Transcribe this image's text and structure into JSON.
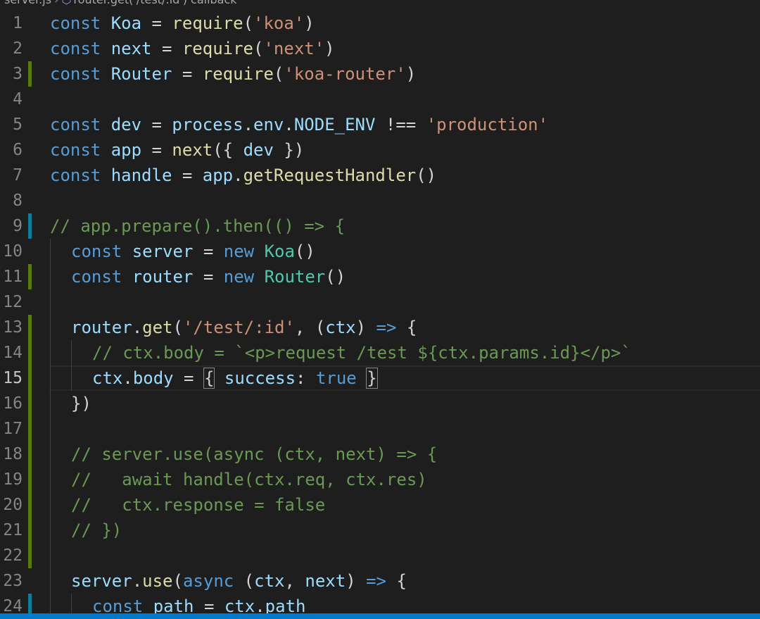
{
  "breadcrumb": {
    "file": "server.js",
    "symbol": "router.get('/test/:id') callback"
  },
  "current_line": 15,
  "lines": [
    {
      "n": "1",
      "tokens": [
        [
          "kw",
          "const "
        ],
        [
          "var",
          "Koa"
        ],
        [
          "op",
          " = "
        ],
        [
          "fn",
          "require"
        ],
        [
          "op",
          "("
        ],
        [
          "str",
          "'koa'"
        ],
        [
          "op",
          ")"
        ]
      ]
    },
    {
      "n": "2",
      "tokens": [
        [
          "kw",
          "const "
        ],
        [
          "var",
          "next"
        ],
        [
          "op",
          " = "
        ],
        [
          "fn",
          "require"
        ],
        [
          "op",
          "("
        ],
        [
          "str",
          "'next'"
        ],
        [
          "op",
          ")"
        ]
      ]
    },
    {
      "n": "3",
      "mark": "green",
      "tokens": [
        [
          "kw",
          "const "
        ],
        [
          "var",
          "Router"
        ],
        [
          "op",
          " = "
        ],
        [
          "fn",
          "require"
        ],
        [
          "op",
          "("
        ],
        [
          "str",
          "'koa-router'"
        ],
        [
          "op",
          ")"
        ]
      ]
    },
    {
      "n": "4",
      "tokens": []
    },
    {
      "n": "5",
      "tokens": [
        [
          "kw",
          "const "
        ],
        [
          "var",
          "dev"
        ],
        [
          "op",
          " = "
        ],
        [
          "var",
          "process"
        ],
        [
          "op",
          "."
        ],
        [
          "var",
          "env"
        ],
        [
          "op",
          "."
        ],
        [
          "var",
          "NODE_ENV"
        ],
        [
          "op",
          " !== "
        ],
        [
          "str",
          "'production'"
        ]
      ]
    },
    {
      "n": "6",
      "tokens": [
        [
          "kw",
          "const "
        ],
        [
          "var",
          "app"
        ],
        [
          "op",
          " = "
        ],
        [
          "fn",
          "next"
        ],
        [
          "op",
          "({ "
        ],
        [
          "var",
          "dev"
        ],
        [
          "op",
          " })"
        ]
      ]
    },
    {
      "n": "7",
      "tokens": [
        [
          "kw",
          "const "
        ],
        [
          "var",
          "handle"
        ],
        [
          "op",
          " = "
        ],
        [
          "var",
          "app"
        ],
        [
          "op",
          "."
        ],
        [
          "fn",
          "getRequestHandler"
        ],
        [
          "op",
          "()"
        ]
      ]
    },
    {
      "n": "8",
      "tokens": []
    },
    {
      "n": "9",
      "mark": "blue",
      "tokens": [
        [
          "cmt",
          "// app.prepare().then(() => {"
        ]
      ]
    },
    {
      "n": "10",
      "indent": 1,
      "tokens": [
        [
          "kw",
          "const "
        ],
        [
          "var",
          "server"
        ],
        [
          "op",
          " = "
        ],
        [
          "kw",
          "new "
        ],
        [
          "cls",
          "Koa"
        ],
        [
          "op",
          "()"
        ]
      ]
    },
    {
      "n": "11",
      "indent": 1,
      "mark": "green",
      "tokens": [
        [
          "kw",
          "const "
        ],
        [
          "var",
          "router"
        ],
        [
          "op",
          " = "
        ],
        [
          "kw",
          "new "
        ],
        [
          "cls",
          "Router"
        ],
        [
          "op",
          "()"
        ]
      ]
    },
    {
      "n": "12",
      "indent": 1,
      "tokens": []
    },
    {
      "n": "13",
      "indent": 1,
      "mark": "green",
      "tokens": [
        [
          "var",
          "router"
        ],
        [
          "op",
          "."
        ],
        [
          "fn",
          "get"
        ],
        [
          "op",
          "("
        ],
        [
          "str",
          "'/test/:id'"
        ],
        [
          "op",
          ", ("
        ],
        [
          "var",
          "ctx"
        ],
        [
          "op",
          ") "
        ],
        [
          "kw",
          "=>"
        ],
        [
          "op",
          " {"
        ]
      ]
    },
    {
      "n": "14",
      "indent": 2,
      "mark": "green",
      "tokens": [
        [
          "cmt",
          "// ctx.body = `<p>request /test ${ctx.params.id}</p>`"
        ]
      ]
    },
    {
      "n": "15",
      "indent": 2,
      "mark": "green",
      "tokens": [
        [
          "var",
          "ctx"
        ],
        [
          "op",
          "."
        ],
        [
          "var",
          "body"
        ],
        [
          "op",
          " = "
        ],
        [
          "brk",
          "{"
        ],
        [
          "op",
          " "
        ],
        [
          "var",
          "success"
        ],
        [
          "op",
          ": "
        ],
        [
          "kw",
          "true"
        ],
        [
          "op",
          " "
        ],
        [
          "brk",
          "}"
        ]
      ]
    },
    {
      "n": "16",
      "indent": 1,
      "mark": "green",
      "tokens": [
        [
          "op",
          "})"
        ]
      ]
    },
    {
      "n": "17",
      "indent": 1,
      "mark": "green",
      "tokens": []
    },
    {
      "n": "18",
      "indent": 1,
      "mark": "green",
      "tokens": [
        [
          "cmt",
          "// server.use(async (ctx, next) => {"
        ]
      ]
    },
    {
      "n": "19",
      "indent": 1,
      "mark": "green",
      "tokens": [
        [
          "cmt",
          "//   await handle(ctx.req, ctx.res)"
        ]
      ]
    },
    {
      "n": "20",
      "indent": 1,
      "mark": "green",
      "tokens": [
        [
          "cmt",
          "//   ctx.response = false"
        ]
      ]
    },
    {
      "n": "21",
      "indent": 1,
      "mark": "green",
      "tokens": [
        [
          "cmt",
          "// })"
        ]
      ]
    },
    {
      "n": "22",
      "indent": 1,
      "mark": "green",
      "tokens": []
    },
    {
      "n": "23",
      "indent": 1,
      "tokens": [
        [
          "var",
          "server"
        ],
        [
          "op",
          "."
        ],
        [
          "fn",
          "use"
        ],
        [
          "op",
          "("
        ],
        [
          "kw",
          "async"
        ],
        [
          "op",
          " ("
        ],
        [
          "var",
          "ctx"
        ],
        [
          "op",
          ", "
        ],
        [
          "var",
          "next"
        ],
        [
          "op",
          ") "
        ],
        [
          "kw",
          "=>"
        ],
        [
          "op",
          " {"
        ]
      ]
    },
    {
      "n": "24",
      "indent": 2,
      "mark": "blue",
      "tokens": [
        [
          "kw",
          "const "
        ],
        [
          "var",
          "path"
        ],
        [
          "op",
          " = "
        ],
        [
          "var",
          "ctx"
        ],
        [
          "op",
          "."
        ],
        [
          "var",
          "path"
        ]
      ]
    }
  ],
  "colors": {
    "background": "#1e1e1e",
    "statusbar": "#007acc",
    "added": "#587c0c",
    "modified": "#0c7d9d"
  }
}
